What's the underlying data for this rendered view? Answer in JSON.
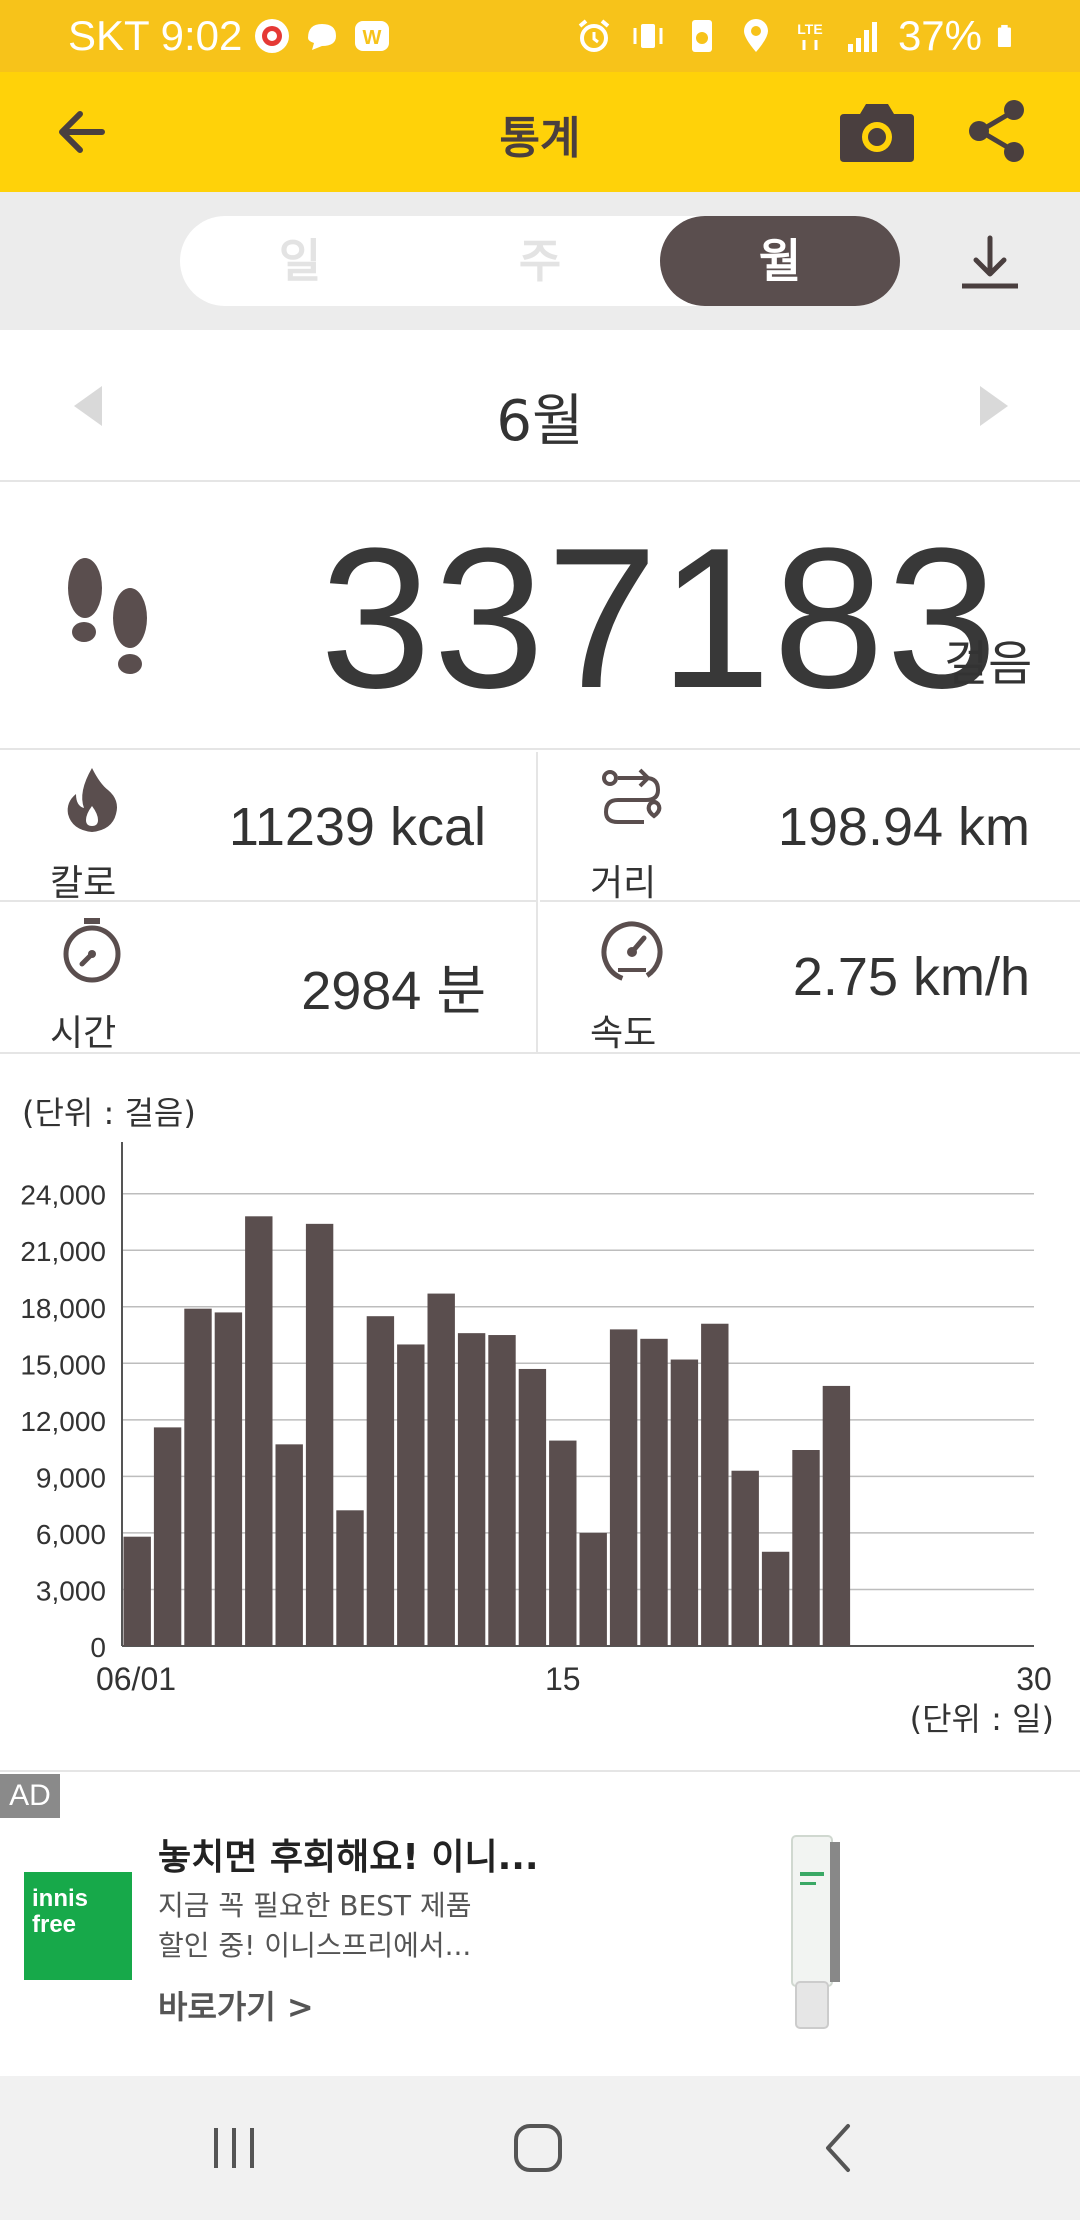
{
  "status_bar": {
    "carrier_time": "SKT 9:02",
    "network": "LTE",
    "battery": "37%"
  },
  "app_bar": {
    "title": "통계",
    "icons": [
      "back-arrow-icon",
      "camera-icon",
      "share-icon"
    ]
  },
  "period_tabs": {
    "tabs": [
      {
        "label": "일",
        "selected": false
      },
      {
        "label": "주",
        "selected": false
      },
      {
        "label": "월",
        "selected": true
      }
    ]
  },
  "period": {
    "label": "6월"
  },
  "summary": {
    "steps": "337183",
    "steps_unit": "걸음"
  },
  "stats": [
    {
      "icon": "flame-icon",
      "label": "칼로",
      "value": "11239 kcal"
    },
    {
      "icon": "route-icon",
      "label": "거리",
      "value": "198.94 km"
    },
    {
      "icon": "stopwatch-icon",
      "label": "시간",
      "value": "2984 분"
    },
    {
      "icon": "speedometer-icon",
      "label": "속도",
      "value": "2.75 km/h"
    }
  ],
  "chart_data": {
    "type": "bar",
    "y_unit_label": "(단위 : 걸음)",
    "x_unit_label": "(단위 : 일)",
    "x_tick_labels": [
      "06/01",
      "15",
      "30"
    ],
    "y_tick_labels": [
      "0",
      "3,000",
      "6,000",
      "9,000",
      "12,000",
      "15,000",
      "18,000",
      "21,000",
      "24,000"
    ],
    "ylim": [
      0,
      26000
    ],
    "x_range": [
      1,
      30
    ],
    "grid": true,
    "bar_color": "#5a4e4e",
    "x": [
      1,
      2,
      3,
      4,
      5,
      6,
      7,
      8,
      9,
      10,
      11,
      12,
      13,
      14,
      15,
      16,
      17,
      18,
      19,
      20,
      21,
      22,
      23,
      24
    ],
    "values": [
      5800,
      11600,
      17900,
      17700,
      22800,
      10700,
      22400,
      7200,
      17500,
      16000,
      18700,
      16600,
      16500,
      14700,
      10900,
      6000,
      16800,
      16300,
      15200,
      17100,
      9300,
      5000,
      10400,
      13800
    ]
  },
  "ad": {
    "badge": "AD",
    "logo_line1": "innis",
    "logo_line2": "free",
    "headline": "놓치면 후회해요! 이니...",
    "description": "지금 꼭 필요한 BEST 제품 할인 중! 이니스프리에서...",
    "cta": "바로가기 >"
  },
  "nav_bar": {
    "icons": [
      "recents-icon",
      "home-icon",
      "back-icon"
    ]
  },
  "colors": {
    "status_bar": "#f7c31a",
    "app_bar": "#ffd209",
    "accent_dark": "#5a4e4e"
  }
}
